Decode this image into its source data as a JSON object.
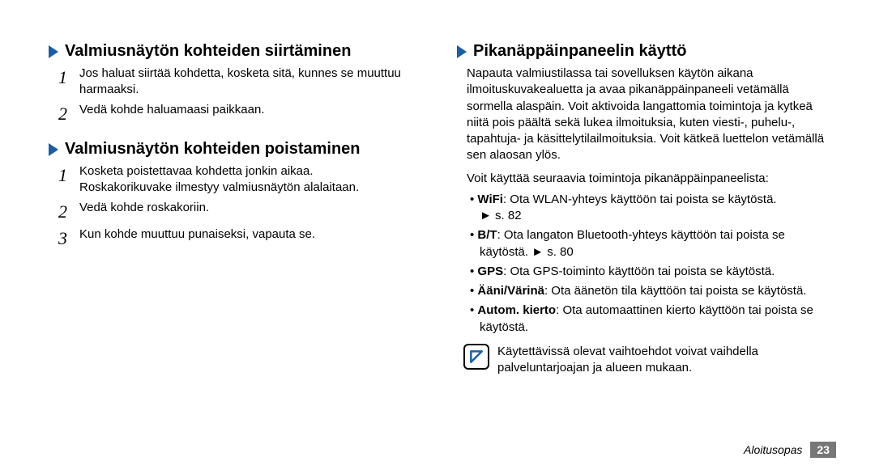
{
  "left": {
    "heading1": "Valmiusnäytön kohteiden siirtäminen",
    "steps1": [
      "Jos haluat siirtää kohdetta, kosketa sitä, kunnes se muuttuu harmaaksi.",
      "Vedä kohde haluamaasi paikkaan."
    ],
    "heading2": "Valmiusnäytön kohteiden poistaminen",
    "steps2": [
      {
        "main": "Kosketa poistettavaa kohdetta jonkin aikaa.",
        "sub": "Roskakorikuvake ilmestyy valmiusnäytön alalaitaan."
      },
      {
        "main": "Vedä kohde roskakoriin."
      },
      {
        "main": "Kun kohde muuttuu punaiseksi, vapauta se."
      }
    ]
  },
  "right": {
    "heading": "Pikanäppäinpaneelin käyttö",
    "intro": "Napauta valmiustilassa tai sovelluksen käytön aikana ilmoituskuvakealuetta ja avaa pikanäppäinpaneeli vetämällä sormella alaspäin. Voit aktivoida langattomia toimintoja ja kytkeä niitä pois päältä sekä lukea ilmoituksia, kuten viesti-, puhelu-, tapahtuja- ja käsittelytilailmoituksia. Voit kätkeä luettelon vetämällä sen alaosan ylös.",
    "lead": "Voit käyttää seuraavia toimintoja pikanäppäinpaneelista:",
    "bullets": [
      {
        "label": "WiFi",
        "desc": ": Ota WLAN-yhteys käyttöön tai poista se käytöstä.",
        "ref": "s. 82"
      },
      {
        "label": "B/T",
        "desc": ": Ota langaton Bluetooth-yhteys käyttöön tai poista se käytöstä.",
        "ref": "s. 80"
      },
      {
        "label": "GPS",
        "desc": ": Ota GPS-toiminto käyttöön tai poista se käytöstä."
      },
      {
        "label": "Ääni/Värinä",
        "desc": ": Ota äänetön tila käyttöön tai poista se käytöstä."
      },
      {
        "label": "Autom. kierto",
        "desc": ": Ota automaattinen kierto käyttöön tai poista se käytöstä."
      }
    ],
    "note": "Käytettävissä olevat vaihtoehdot voivat vaihdella palveluntarjoajan ja alueen mukaan."
  },
  "footer": {
    "section": "Aloitusopas",
    "page": "23"
  }
}
